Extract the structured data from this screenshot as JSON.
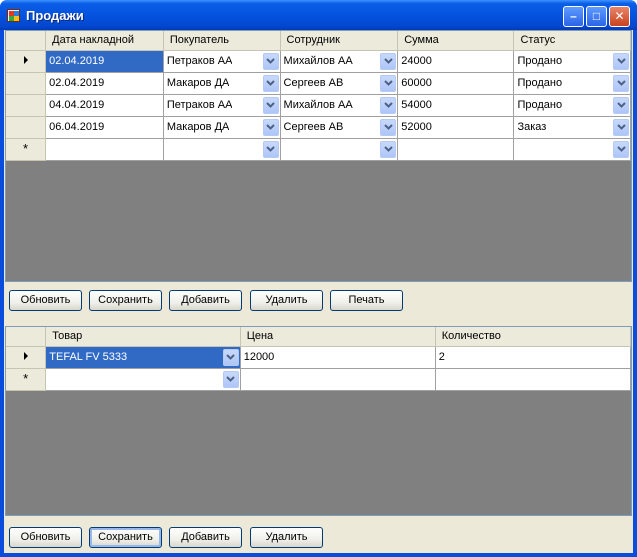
{
  "window": {
    "title": "Продажи",
    "controls": {
      "minimize": "–",
      "maximize": "□",
      "close": "✕"
    }
  },
  "sales_grid": {
    "columns": [
      "Дата накладной",
      "Покупатель",
      "Сотрудник",
      "Сумма",
      "Статус"
    ],
    "rows": [
      {
        "date": "02.04.2019",
        "buyer": "Петраков АА",
        "employee": "Михайлов АА",
        "sum": "24000",
        "status": "Продано"
      },
      {
        "date": "02.04.2019",
        "buyer": "Макаров ДА",
        "employee": "Сергеев АВ",
        "sum": "60000",
        "status": "Продано"
      },
      {
        "date": "04.04.2019",
        "buyer": "Петраков АА",
        "employee": "Михайлов АА",
        "sum": "54000",
        "status": "Продано"
      },
      {
        "date": "06.04.2019",
        "buyer": "Макаров ДА",
        "employee": "Сергеев АВ",
        "sum": "52000",
        "status": "Заказ"
      }
    ],
    "new_row_marker": "*"
  },
  "sales_buttons": {
    "refresh": "Обновить",
    "save": "Сохранить",
    "add": "Добавить",
    "delete": "Удалить",
    "print": "Печать"
  },
  "items_grid": {
    "columns": [
      "Товар",
      "Цена",
      "Количество"
    ],
    "rows": [
      {
        "product": "TEFAL FV 5333",
        "price": "12000",
        "quantity": "2"
      }
    ],
    "new_row_marker": "*"
  },
  "items_buttons": {
    "refresh": "Обновить",
    "save": "Сохранить",
    "add": "Добавить",
    "delete": "Удалить"
  }
}
